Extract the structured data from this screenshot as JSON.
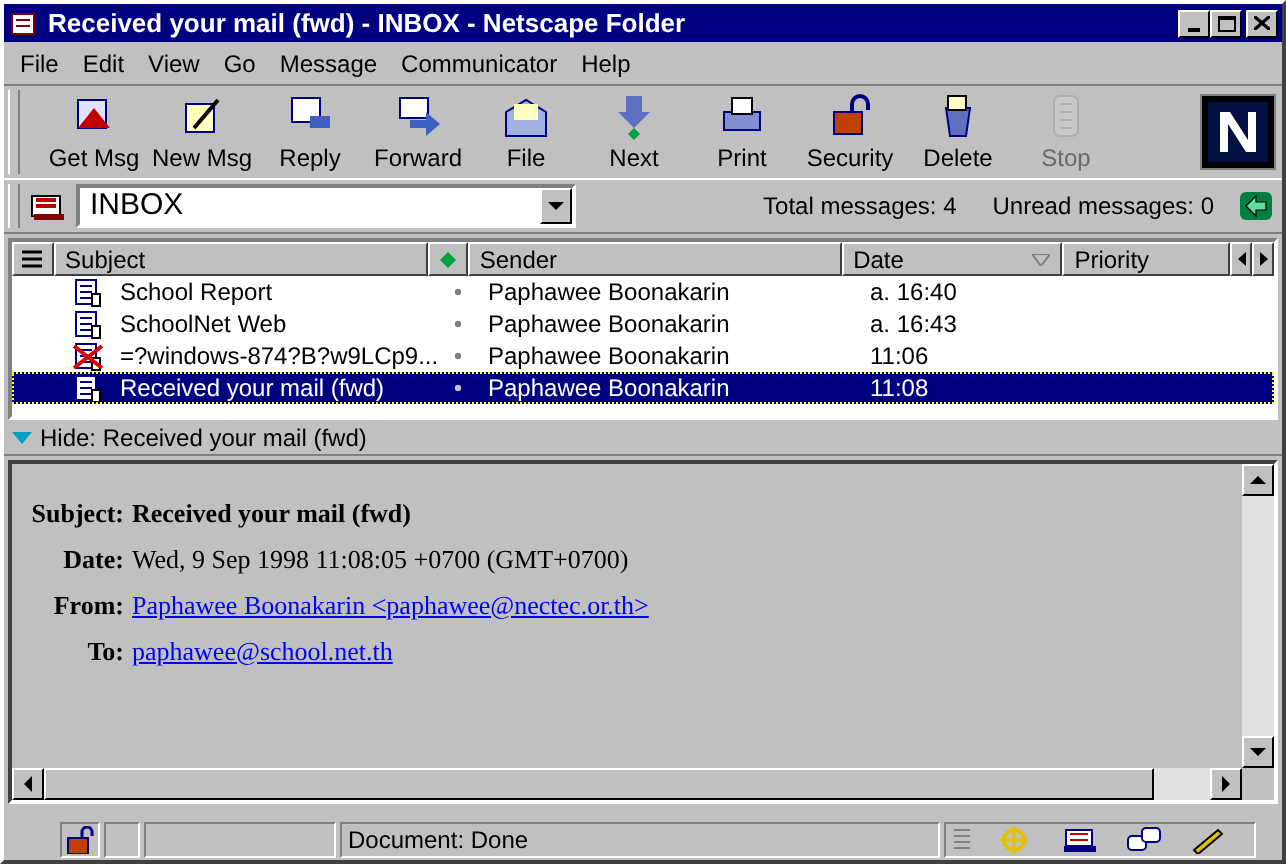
{
  "window": {
    "title": "Received your mail (fwd) - INBOX - Netscape Folder"
  },
  "menu": [
    "File",
    "Edit",
    "View",
    "Go",
    "Message",
    "Communicator",
    "Help"
  ],
  "toolbar": [
    {
      "label": "Get Msg",
      "disabled": false
    },
    {
      "label": "New Msg",
      "disabled": false
    },
    {
      "label": "Reply",
      "disabled": false
    },
    {
      "label": "Forward",
      "disabled": false
    },
    {
      "label": "File",
      "disabled": false
    },
    {
      "label": "Next",
      "disabled": false
    },
    {
      "label": "Print",
      "disabled": false
    },
    {
      "label": "Security",
      "disabled": false
    },
    {
      "label": "Delete",
      "disabled": false
    },
    {
      "label": "Stop",
      "disabled": true
    }
  ],
  "folder": {
    "value": "INBOX",
    "total": "Total messages: 4",
    "unread": "Unread messages: 0"
  },
  "table": {
    "columns": [
      "Subject",
      "Sender",
      "Date",
      "Priority"
    ],
    "rows": [
      {
        "subject": "School Report",
        "sender": "Paphawee Boonakarin",
        "date": "a. 16:40",
        "kind": "normal",
        "selected": false
      },
      {
        "subject": "SchoolNet Web",
        "sender": "Paphawee Boonakarin",
        "date": "a. 16:43",
        "kind": "normal",
        "selected": false
      },
      {
        "subject": "=?windows-874?B?w9LCp9...",
        "sender": "Paphawee Boonakarin",
        "date": "11:06",
        "kind": "deleted",
        "selected": false
      },
      {
        "subject": "Received your mail  (fwd)",
        "sender": "Paphawee Boonakarin",
        "date": "11:08",
        "kind": "normal",
        "selected": true
      }
    ]
  },
  "hide_bar": "Hide: Received your mail  (fwd)",
  "message": {
    "headers": [
      {
        "label": "Subject:",
        "value": "Received your mail (fwd)",
        "kind": "bold"
      },
      {
        "label": "Date:",
        "value": "Wed, 9 Sep 1998 11:08:05 +0700 (GMT+0700)",
        "kind": "text"
      },
      {
        "label": "From:",
        "value": "Paphawee Boonakarin <paphawee@nectec.or.th>",
        "kind": "link"
      },
      {
        "label": "To:",
        "value": "paphawee@school.net.th",
        "kind": "link"
      }
    ]
  },
  "status_bar": {
    "text": "Document: Done"
  }
}
